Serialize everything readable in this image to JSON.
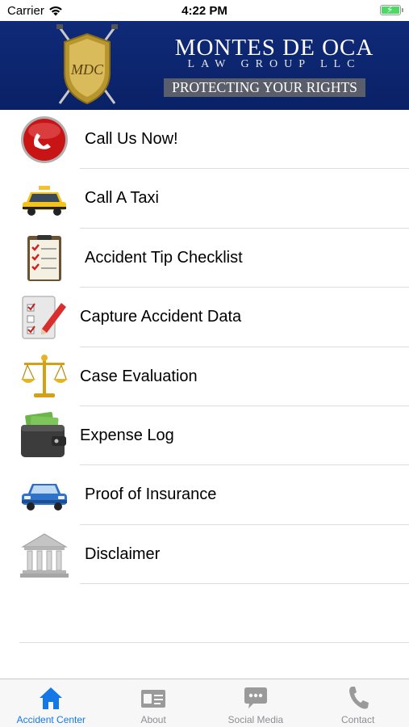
{
  "status_bar": {
    "carrier": "Carrier",
    "time": "4:22 PM"
  },
  "header": {
    "firm_name": "MONTES DE OCA",
    "firm_subtitle": "LAW GROUP LLC",
    "tagline": "PROTECTING YOUR RIGHTS",
    "logo_text": "MDC"
  },
  "menu": {
    "items": [
      {
        "label": "Call Us Now!",
        "icon": "phone-icon"
      },
      {
        "label": "Call A Taxi",
        "icon": "taxi-icon"
      },
      {
        "label": "Accident Tip Checklist",
        "icon": "checklist-icon"
      },
      {
        "label": "Capture Accident Data",
        "icon": "clipboard-pencil-icon"
      },
      {
        "label": "Case Evaluation",
        "icon": "scales-icon"
      },
      {
        "label": "Expense Log",
        "icon": "wallet-icon"
      },
      {
        "label": "Proof of Insurance",
        "icon": "car-icon"
      },
      {
        "label": "Disclaimer",
        "icon": "courthouse-icon"
      }
    ]
  },
  "tabs": [
    {
      "label": "Accident Center",
      "icon": "home-icon",
      "active": true
    },
    {
      "label": "About",
      "icon": "id-card-icon",
      "active": false
    },
    {
      "label": "Social Media",
      "icon": "chat-bubble-icon",
      "active": false
    },
    {
      "label": "Contact",
      "icon": "phone-handset-icon",
      "active": false
    }
  ],
  "colors": {
    "banner": "#0a2166",
    "accent": "#1479e6",
    "tab_inactive": "#8e8e93"
  }
}
